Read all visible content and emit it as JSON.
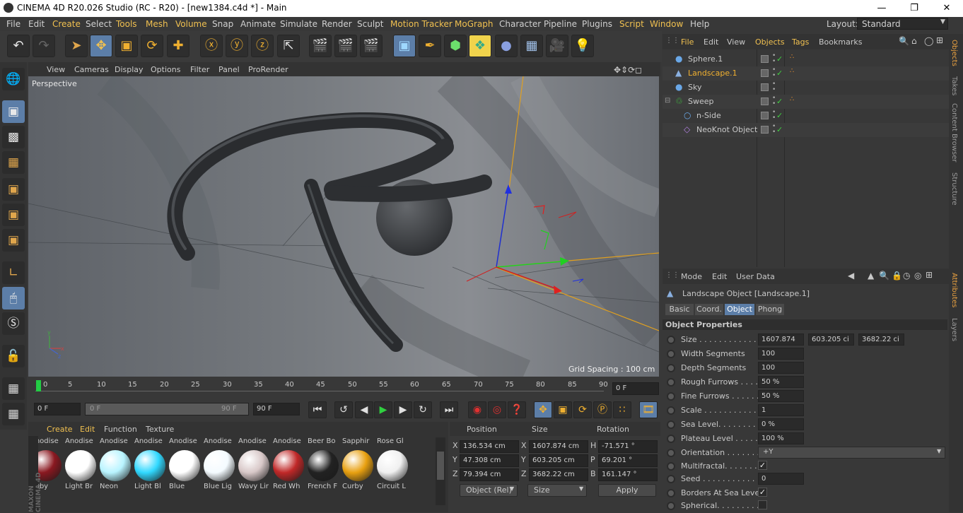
{
  "window": {
    "title": "CINEMA 4D R20.026 Studio (RC - R20) - [new1384.c4d *] - Main"
  },
  "menubar": {
    "items": [
      "File",
      "Edit",
      "Create",
      "Select",
      "Tools",
      "Mesh",
      "Volume",
      "Snap",
      "Animate",
      "Simulate",
      "Render",
      "Sculpt",
      "Motion Tracker",
      "MoGraph",
      "Character",
      "Pipeline",
      "Plugins",
      "Script",
      "Window",
      "Help"
    ],
    "layout_label": "Layout:",
    "layout_value": "Standard"
  },
  "viewport": {
    "menu": [
      "View",
      "Cameras",
      "Display",
      "Options",
      "Filter",
      "Panel",
      "ProRender"
    ],
    "label": "Perspective",
    "grid_spacing": "Grid Spacing : 100 cm"
  },
  "timeline": {
    "ticks": [
      "0",
      "5",
      "10",
      "15",
      "20",
      "25",
      "30",
      "35",
      "40",
      "45",
      "50",
      "55",
      "60",
      "65",
      "70",
      "75",
      "80",
      "85",
      "90"
    ],
    "current_frame": "0 F"
  },
  "transport": {
    "start": "0 F",
    "range_start": "0 F",
    "range_end": "90 F",
    "end": "90 F"
  },
  "materials": {
    "menu": [
      "Create",
      "Edit",
      "Function",
      "Texture"
    ],
    "row1": [
      "Anodise",
      "Anodise",
      "Anodise",
      "Anodise",
      "Anodise",
      "Anodise",
      "Anodise",
      "Anodise",
      "Beer Bo",
      "Sapphir",
      "Rose Gl"
    ],
    "row2": [
      {
        "name": "Ruby",
        "color": "#8a1820"
      },
      {
        "name": "Light Br",
        "color": "#ffffff"
      },
      {
        "name": "Neon",
        "color": "#b8f4ff"
      },
      {
        "name": "Light Bl",
        "color": "#30d8ff"
      },
      {
        "name": "Blue",
        "color": "#ffffff"
      },
      {
        "name": "Blue Lig",
        "color": "#f4fbff"
      },
      {
        "name": "Wavy Lir",
        "color": "#d8c8c8"
      },
      {
        "name": "Red Wh",
        "color": "#c02828"
      },
      {
        "name": "French F",
        "color": "#222222"
      },
      {
        "name": "Curby",
        "color": "#e8a010"
      },
      {
        "name": "Circuit L",
        "color": "#f0f0f0"
      }
    ]
  },
  "coords": {
    "headers": [
      "Position",
      "Size",
      "Rotation"
    ],
    "rows": [
      {
        "axis": "X",
        "pos": "136.534 cm",
        "size_axis": "X",
        "size": "1607.874 cm",
        "rot_axis": "H",
        "rot": "-71.571 °"
      },
      {
        "axis": "Y",
        "pos": "47.308 cm",
        "size_axis": "Y",
        "size": "603.205 cm",
        "rot_axis": "P",
        "rot": "69.201 °"
      },
      {
        "axis": "Z",
        "pos": "79.394 cm",
        "size_axis": "Z",
        "size": "3682.22 cm",
        "rot_axis": "B",
        "rot": "161.147 °"
      }
    ],
    "mode": "Object (Rel)",
    "size_mode": "Size",
    "apply": "Apply"
  },
  "objects": {
    "menu": [
      "File",
      "Edit",
      "View",
      "Objects",
      "Tags",
      "Bookmarks"
    ],
    "items": [
      {
        "name": "Sphere.1",
        "indent": 0,
        "color": "#c8c8c8"
      },
      {
        "name": "Landscape.1",
        "indent": 0,
        "color": "#f0b030"
      },
      {
        "name": "Sky",
        "indent": 0,
        "color": "#c8c8c8"
      },
      {
        "name": "Sweep",
        "indent": 0,
        "color": "#c8c8c8"
      },
      {
        "name": "n-Side",
        "indent": 1,
        "color": "#c8c8c8"
      },
      {
        "name": "NeoKnot Object",
        "indent": 1,
        "color": "#c8c8c8"
      }
    ]
  },
  "attributes": {
    "menu": [
      "Mode",
      "Edit",
      "User Data"
    ],
    "title": "Landscape Object [Landscape.1]",
    "tabs": [
      "Basic",
      "Coord.",
      "Object",
      "Phong"
    ],
    "active_tab": "Object",
    "section": "Object Properties",
    "size_label": "Size . . . . . . . . . . . .",
    "size": [
      "1607.874",
      "603.205 ci",
      "3682.22 ci"
    ],
    "rows": [
      {
        "label": "Width Segments",
        "value": "100"
      },
      {
        "label": "Depth Segments",
        "value": "100"
      },
      {
        "label": "Rough Furrows . . . .",
        "value": "50 %"
      },
      {
        "label": "Fine Furrows . . . . . .",
        "value": "50 %"
      },
      {
        "label": "Scale . . . . . . . . . . . .",
        "value": "1"
      },
      {
        "label": "Sea Level. . . . . . . . .",
        "value": "0 %"
      },
      {
        "label": "Plateau Level . . . . .",
        "value": "100 %"
      }
    ],
    "orientation_label": "Orientation . . . . . . .",
    "orientation": "+Y",
    "multifractal": "Multifractal. . . . . . .",
    "seed_label": "Seed . . . . . . . . . . . .",
    "seed": "0",
    "borders": "Borders At Sea Level",
    "spherical": "Spherical. . . . . . . . ."
  },
  "rightstrip": {
    "upper": [
      "Objects",
      "Takes",
      "Content Browser",
      "Structure"
    ],
    "lower": [
      "Attributes",
      "Layers"
    ]
  }
}
